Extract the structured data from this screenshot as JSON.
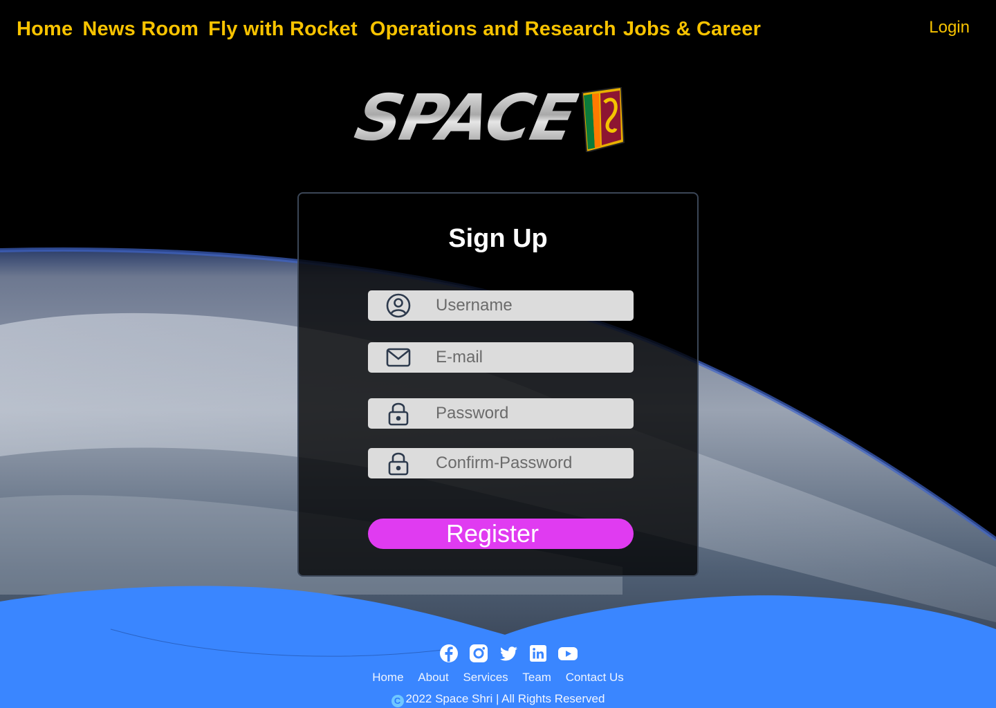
{
  "nav": {
    "items": [
      {
        "label": "Home"
      },
      {
        "label": "News Room"
      },
      {
        "label": "Fly with Rocket"
      },
      {
        "label": "Operations and Research"
      },
      {
        "label": "Jobs & Career"
      }
    ],
    "login_label": "Login"
  },
  "logo": {
    "wordmark": "SPACE"
  },
  "form": {
    "title": "Sign Up",
    "fields": [
      {
        "placeholder": "Username",
        "icon": "user-circle-icon"
      },
      {
        "placeholder": "E-mail",
        "icon": "envelope-icon"
      },
      {
        "placeholder": "Password",
        "icon": "lock-icon"
      },
      {
        "placeholder": "Confirm-Password",
        "icon": "lock-icon"
      }
    ],
    "submit_label": "Register"
  },
  "footer": {
    "socials": [
      "facebook-icon",
      "instagram-icon",
      "twitter-icon",
      "linkedin-icon",
      "youtube-icon"
    ],
    "links": [
      {
        "label": "Home"
      },
      {
        "label": "About"
      },
      {
        "label": "Services"
      },
      {
        "label": "Team"
      },
      {
        "label": "Contact Us"
      }
    ],
    "copyright_symbol": "C",
    "copyright_text": "2022 Space Shri | All Rights Reserved"
  },
  "colors": {
    "nav_text": "#f8c300",
    "button": "#e03bf1",
    "footer": "#3a86ff",
    "field_bg": "#dcdcdc"
  }
}
